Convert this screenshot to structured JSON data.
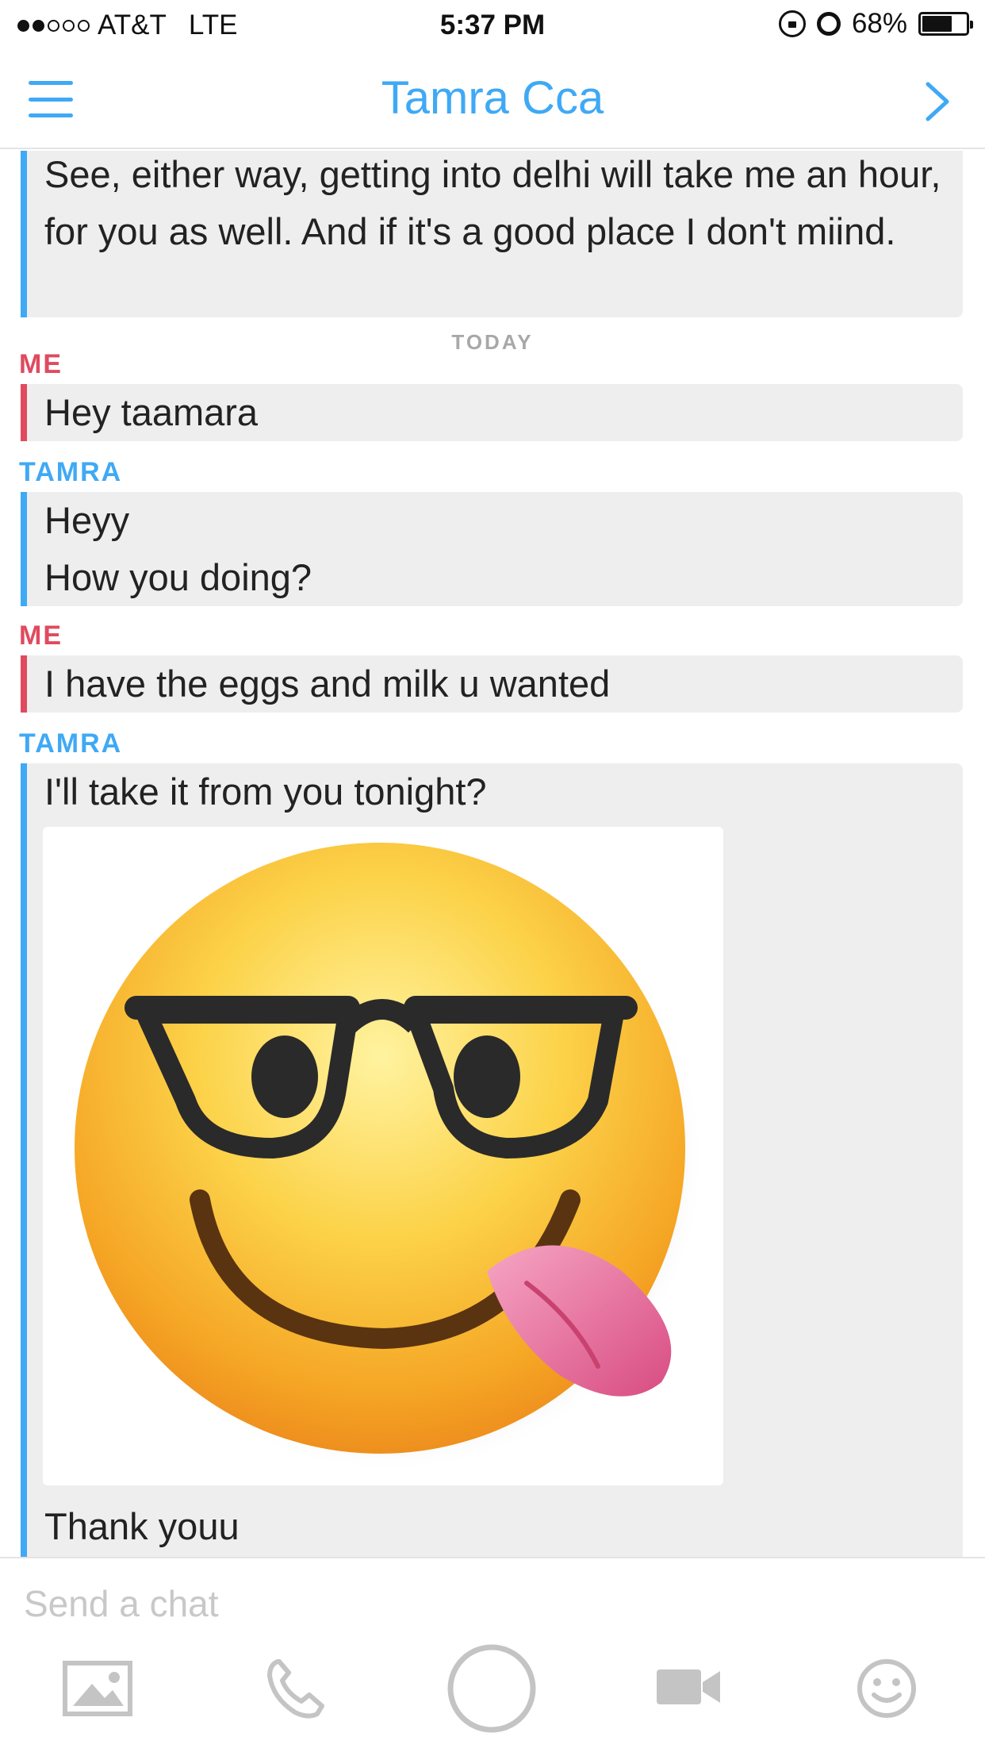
{
  "status_bar": {
    "carrier": "AT&T",
    "network": "LTE",
    "time": "5:37 PM",
    "battery": "68%",
    "battery_level": 0.68
  },
  "header": {
    "title": "Tamra Cca",
    "left_icon": "hamburger-menu-icon",
    "right_icon": "chevron-right-icon",
    "accent_color": "#3fa9f5"
  },
  "colors": {
    "me": "#e04a5f",
    "them": "#3fa9f5",
    "bubble_bg": "#eeeeee"
  },
  "messages": {
    "prev_text": "See, either way, getting into delhi will take me an hour, for you as well. And if it's a good place I don't miind.",
    "day_separator": "TODAY",
    "m1_sender": "ME",
    "m1_text": "Hey taamara",
    "m2_sender": "TAMRA",
    "m2_line1": "Heyy",
    "m2_line2": "How you doing?",
    "m3_sender": "ME",
    "m3_text": "I have the eggs and milk u wanted",
    "m4_sender": "TAMRA",
    "m4_text1": "I'll take it from you tonight?",
    "m4_sticker": "nerd-face-tongue-emoji",
    "m4_text2": "Thank youu"
  },
  "composer": {
    "placeholder": "Send a chat",
    "tools": [
      "image-icon",
      "phone-icon",
      "capture-circle-icon",
      "video-camera-icon",
      "smiley-icon"
    ]
  }
}
